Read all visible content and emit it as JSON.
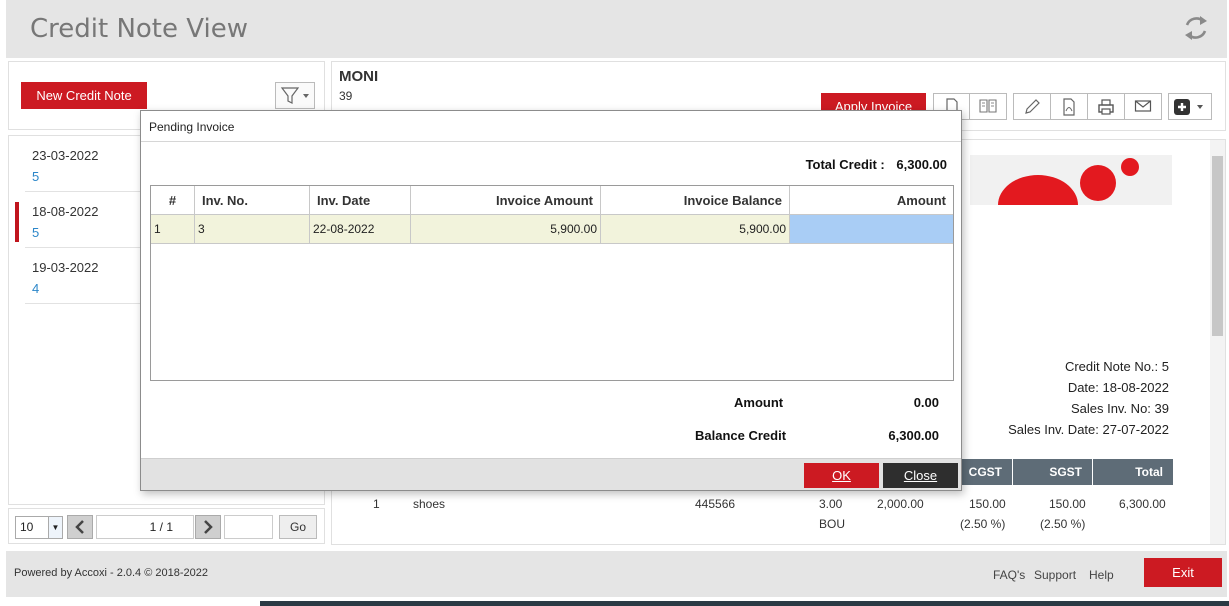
{
  "window": {
    "title": "Credit Note View"
  },
  "left": {
    "new_button": "New Credit Note",
    "items": [
      {
        "date": "23-03-2022",
        "number": "5"
      },
      {
        "date": "18-08-2022",
        "number": "5"
      },
      {
        "date": "19-03-2022",
        "number": "4"
      }
    ],
    "pager": {
      "page_size": "10",
      "page": "1 / 1",
      "go": "Go"
    }
  },
  "header": {
    "customer": "MONI",
    "customer_no": "39",
    "apply_invoice": "Apply Invoice"
  },
  "document": {
    "credit_note_no": "Credit Note No.: 5",
    "date": "Date: 18-08-2022",
    "sales_inv_no": "Sales Inv. No: 39",
    "sales_inv_date": "Sales Inv. Date: 27-07-2022",
    "columns": {
      "cgst": "CGST",
      "sgst": "SGST",
      "total": "Total"
    },
    "row": {
      "sl": "1",
      "item": "shoes",
      "hsn": "445566",
      "qty": "3.00",
      "unit": "BOU",
      "rate": "2,000.00",
      "cgst": "150.00",
      "cgst_pct": "(2.50 %)",
      "sgst": "150.00",
      "sgst_pct": "(2.50 %)",
      "total": "6,300.00"
    }
  },
  "dialog": {
    "title": "Pending Invoice",
    "total_credit_label": "Total Credit :",
    "total_credit_value": "6,300.00",
    "columns": [
      "#",
      "Inv. No.",
      "Inv. Date",
      "Invoice Amount",
      "Invoice Balance",
      "Amount"
    ],
    "rows": [
      {
        "idx": "1",
        "inv_no": "3",
        "inv_date": "22-08-2022",
        "invoice_amount": "5,900.00",
        "invoice_balance": "5,900.00",
        "amount": ""
      }
    ],
    "amount_label": "Amount",
    "amount_value": "0.00",
    "balance_label": "Balance Credit",
    "balance_value": "6,300.00",
    "ok": "OK",
    "close": "Close"
  },
  "footer": {
    "powered": "Powered by Accoxi - 2.0.4 © 2018-2022",
    "faqs": "FAQ's",
    "support": "Support",
    "help": "Help",
    "exit": "Exit"
  },
  "colors": {
    "accent": "#cc1a22",
    "header_dark": "#5e6c77",
    "row_highlight": "#f2f3dc",
    "cell_selected": "#a9cdf5"
  }
}
